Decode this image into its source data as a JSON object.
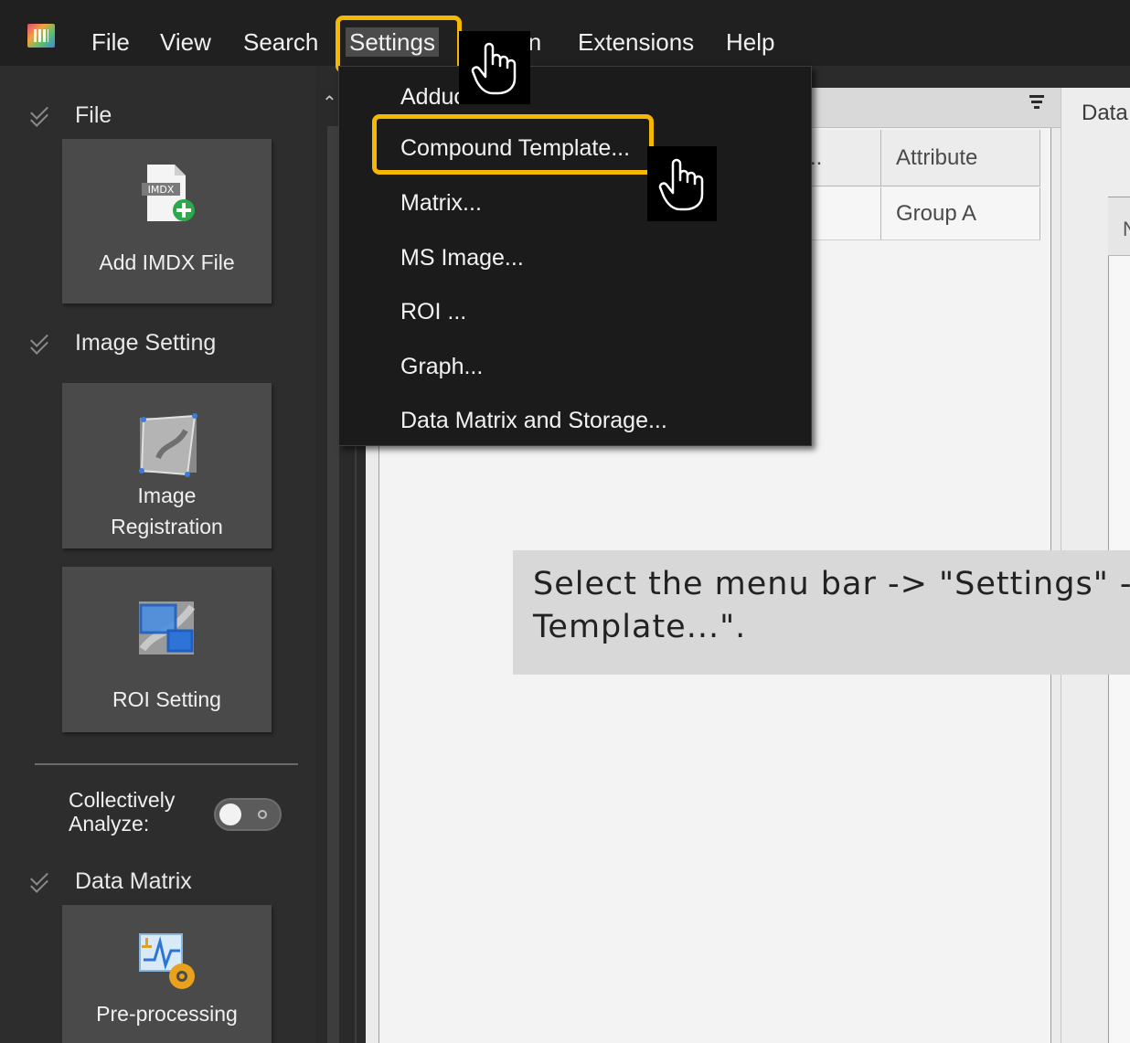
{
  "menubar": {
    "items": [
      "File",
      "View",
      "Search",
      "Settings",
      "Action",
      "Extensions",
      "Help"
    ],
    "active": "Settings"
  },
  "settings_menu": {
    "items": [
      "Adduct Ion...",
      "Compound Template...",
      "Matrix...",
      "MS Image...",
      "ROI ...",
      "Graph...",
      "Data Matrix and Storage..."
    ],
    "highlighted": "Compound Template..."
  },
  "sidebar": {
    "file_section": "File",
    "add_imdx_label": "Add IMDX File",
    "imdx_icon_text": "IMDX",
    "image_setting_section": "Image Setting",
    "image_registration_label": "Image\nRegistration",
    "roi_setting_label": "ROI Setting",
    "collectively_label": "Collectively\nAnalyze:",
    "data_matrix_section": "Data Matrix",
    "preprocessing_label": "Pre-processing"
  },
  "table": {
    "headers": [
      "a...",
      "Attribute"
    ],
    "rows": [
      [
        "",
        "Group A"
      ]
    ]
  },
  "right_panel": {
    "tab": "Data",
    "inner_header": "N"
  },
  "caption": "Select the menu bar -> \"Settings\" -> \"Compound\nTemplate...\".",
  "colors": {
    "highlight": "#f5b700",
    "menubar": "#202020",
    "dropdown": "#1b1b1b",
    "tile": "#4a4a4a"
  }
}
